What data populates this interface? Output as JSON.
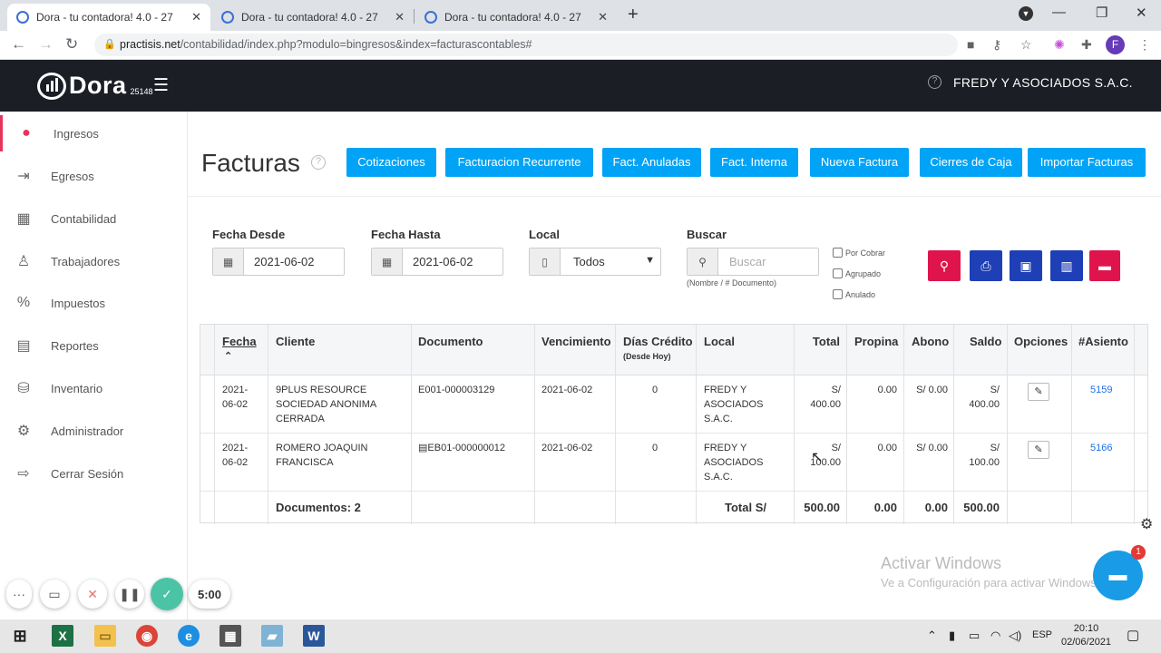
{
  "browser": {
    "tabs": [
      {
        "title": "Dora - tu contadora! 4.0 - 27"
      },
      {
        "title": "Dora - tu contadora! 4.0 - 27"
      },
      {
        "title": "Dora - tu contadora! 4.0 - 27"
      }
    ],
    "url_host": "practisis.net",
    "url_path": "/contabilidad/index.php?modulo=bingresos&index=facturascontables#",
    "profile_initial": "F"
  },
  "header": {
    "logo_text": "Dora",
    "logo_number": "25148",
    "company": "FREDY Y ASOCIADOS S.A.C."
  },
  "sidebar": {
    "items": [
      {
        "label": "Ingresos",
        "icon": "piggy-bank-icon",
        "active": true
      },
      {
        "label": "Egresos",
        "icon": "hand-money-icon"
      },
      {
        "label": "Contabilidad",
        "icon": "calculator-icon"
      },
      {
        "label": "Trabajadores",
        "icon": "workers-icon"
      },
      {
        "label": "Impuestos",
        "icon": "taxes-icon"
      },
      {
        "label": "Reportes",
        "icon": "report-icon"
      },
      {
        "label": "Inventario",
        "icon": "inventory-icon"
      },
      {
        "label": "Administrador",
        "icon": "gear-icon"
      },
      {
        "label": "Cerrar Sesión",
        "icon": "logout-icon"
      }
    ]
  },
  "page": {
    "title": "Facturas",
    "buttons": [
      "Cotizaciones",
      "Facturacion Recurrente",
      "Fact. Anuladas",
      "Fact. Interna",
      "Nueva Factura",
      "Cierres de Caja",
      "Importar Facturas"
    ]
  },
  "filters": {
    "fecha_desde_label": "Fecha Desde",
    "fecha_desde": "2021-06-02",
    "fecha_hasta_label": "Fecha Hasta",
    "fecha_hasta": "2021-06-02",
    "local_label": "Local",
    "local_value": "Todos",
    "buscar_label": "Buscar",
    "buscar_placeholder": "Buscar",
    "buscar_hint": "(Nombre / # Documento)",
    "checkboxes": [
      "Por Cobrar",
      "Agrupado",
      "Anulado"
    ]
  },
  "table": {
    "headers": {
      "fecha": "Fecha",
      "cliente": "Cliente",
      "documento": "Documento",
      "vencimiento": "Vencimiento",
      "dias": "Días Crédito",
      "dias_sub": "(Desde Hoy)",
      "local": "Local",
      "total": "Total",
      "propina": "Propina",
      "abono": "Abono",
      "saldo": "Saldo",
      "opciones": "Opciones",
      "asiento": "#Asiento"
    },
    "rows": [
      {
        "fecha": "2021-06-02",
        "cliente": "9PLUS RESOURCE SOCIEDAD ANONIMA CERRADA",
        "documento": "E001-000003129",
        "vencimiento": "2021-06-02",
        "dias": "0",
        "local": "FREDY Y ASOCIADOS S.A.C.",
        "total": "S/ 400.00",
        "propina": "0.00",
        "abono": "S/ 0.00",
        "saldo": "S/ 400.00",
        "asiento": "5159"
      },
      {
        "fecha": "2021-06-02",
        "cliente": "ROMERO JOAQUIN FRANCISCA",
        "documento": "EB01-000000012",
        "vencimiento": "2021-06-02",
        "dias": "0",
        "local": "FREDY Y ASOCIADOS S.A.C.",
        "total": "S/ 100.00",
        "propina": "0.00",
        "abono": "S/ 0.00",
        "saldo": "S/ 100.00",
        "asiento": "5166"
      }
    ],
    "footer": {
      "documentos": "Documentos: 2",
      "total_label": "Total S/",
      "total": "500.00",
      "propina": "0.00",
      "abono": "0.00",
      "saldo": "500.00"
    }
  },
  "overlay": {
    "timer": "5:00",
    "watermark_title": "Activar Windows",
    "watermark_sub": "Ve a Configuración para activar Windows.",
    "chat_badge": "1"
  },
  "taskbar": {
    "lang": "ESP",
    "time": "20:10",
    "date": "02/06/2021"
  }
}
